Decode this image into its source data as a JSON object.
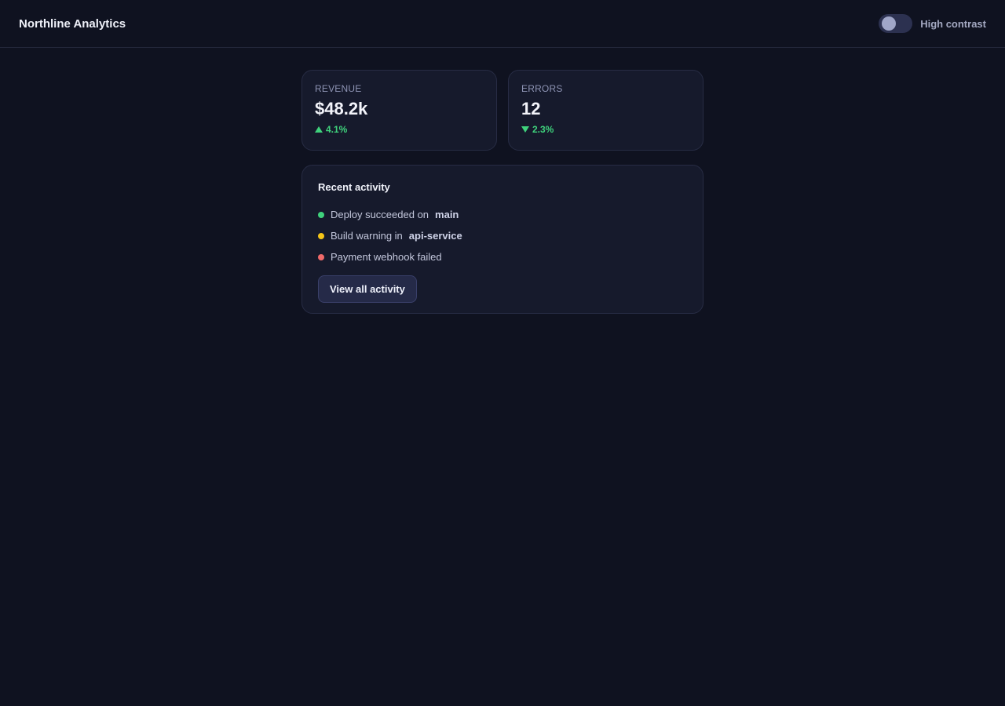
{
  "header": {
    "brand": "Northline Analytics",
    "high_contrast_label": "High contrast",
    "high_contrast_on": false
  },
  "stats": [
    {
      "label": "REVENUE",
      "value": "$48.2k",
      "delta": "4.1%",
      "direction": "up"
    },
    {
      "label": "ERRORS",
      "value": "12",
      "delta": "2.3%",
      "direction": "down"
    }
  ],
  "activity": {
    "title": "Recent activity",
    "items": [
      {
        "text": "Deploy succeeded on",
        "highlight": "main",
        "status_color": "#3fd27c"
      },
      {
        "text": "Build warning in",
        "highlight": "api-service",
        "status_color": "#f5c518"
      },
      {
        "text": "Payment webhook failed",
        "highlight": "",
        "status_color": "#f06a6a"
      }
    ],
    "button_label": "View all activity"
  },
  "colors": {
    "background": "#0f1220",
    "card": "#161a2c",
    "positive": "#3fd27c"
  }
}
